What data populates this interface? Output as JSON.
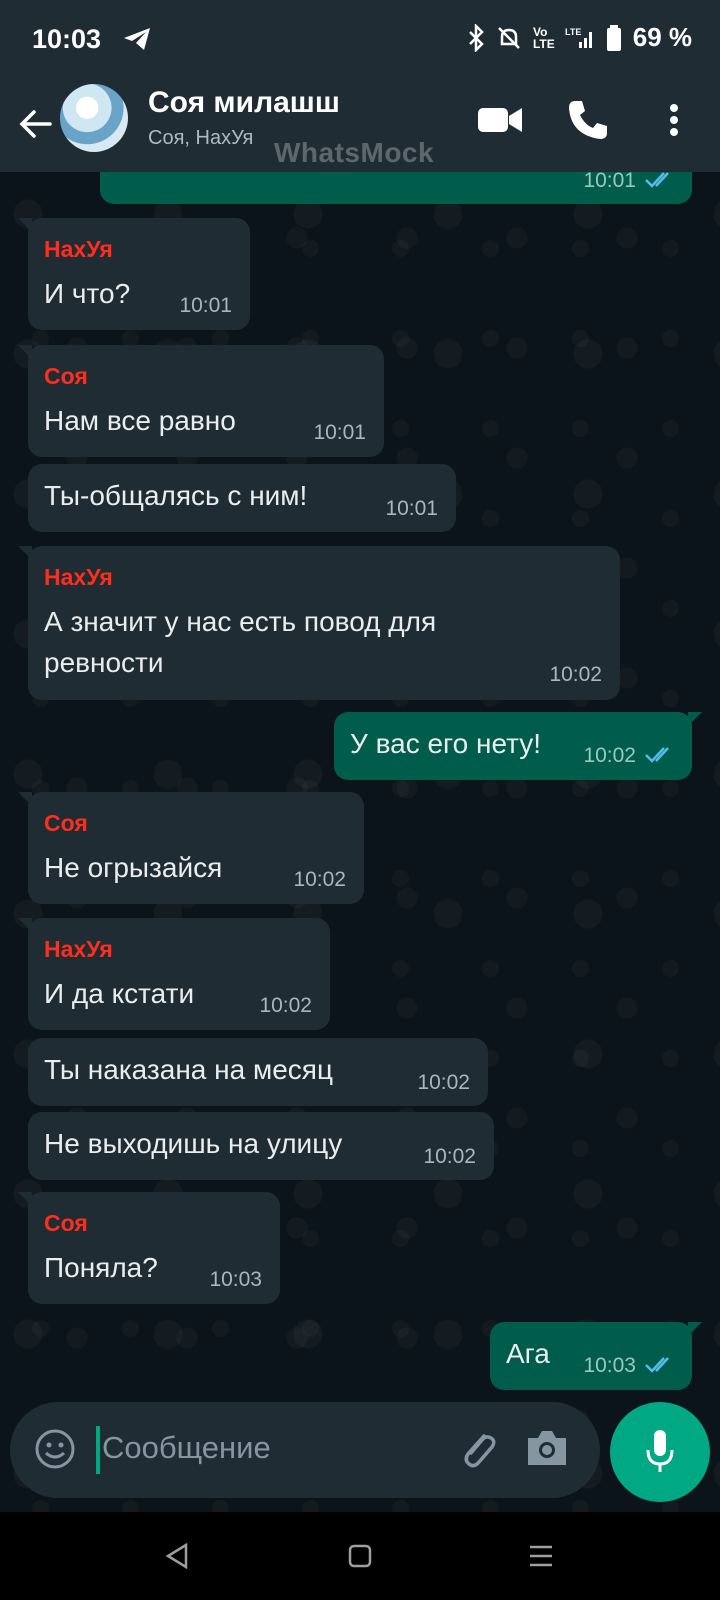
{
  "status_bar": {
    "time": "10:03",
    "battery": "69 %"
  },
  "header": {
    "title": "Соя милашш",
    "subtitle": "Соя, НахУя",
    "watermark": "WhatsMock"
  },
  "colors": {
    "header_bg": "#1f2c34",
    "incoming": "#202c33",
    "outgoing": "#005c4b",
    "accent": "#00a884",
    "sender_name": "#ff2d1e"
  },
  "messages": [
    {
      "time": "10:01"
    },
    {
      "sender": "НахУя",
      "text": "И что?",
      "time": "10:01"
    },
    {
      "sender": "Соя",
      "text": "Нам все равно",
      "time": "10:01"
    },
    {
      "text": "Ты-общалясь с ним!",
      "time": "10:01"
    },
    {
      "sender": "НахУя",
      "text": "А значит у нас есть повод для",
      "text2": "ревности",
      "time": "10:02"
    },
    {
      "text": "У вас его нету!",
      "time": "10:02"
    },
    {
      "sender": "Соя",
      "text": "Не огрызайся",
      "time": "10:02"
    },
    {
      "sender": "НахУя",
      "text": "И да кстати",
      "time": "10:02"
    },
    {
      "text": "Ты наказана на месяц",
      "time": "10:02"
    },
    {
      "text": "Не выходишь на улицу",
      "time": "10:02"
    },
    {
      "sender": "Соя",
      "text": "Поняла?",
      "time": "10:03"
    },
    {
      "text": "Ага",
      "time": "10:03"
    }
  ],
  "composer": {
    "placeholder": "Сообщение"
  },
  "icons": [
    "back-arrow-icon",
    "video-call-icon",
    "phone-icon",
    "more-icon",
    "emoji-icon",
    "attach-icon",
    "camera-icon",
    "mic-icon"
  ]
}
